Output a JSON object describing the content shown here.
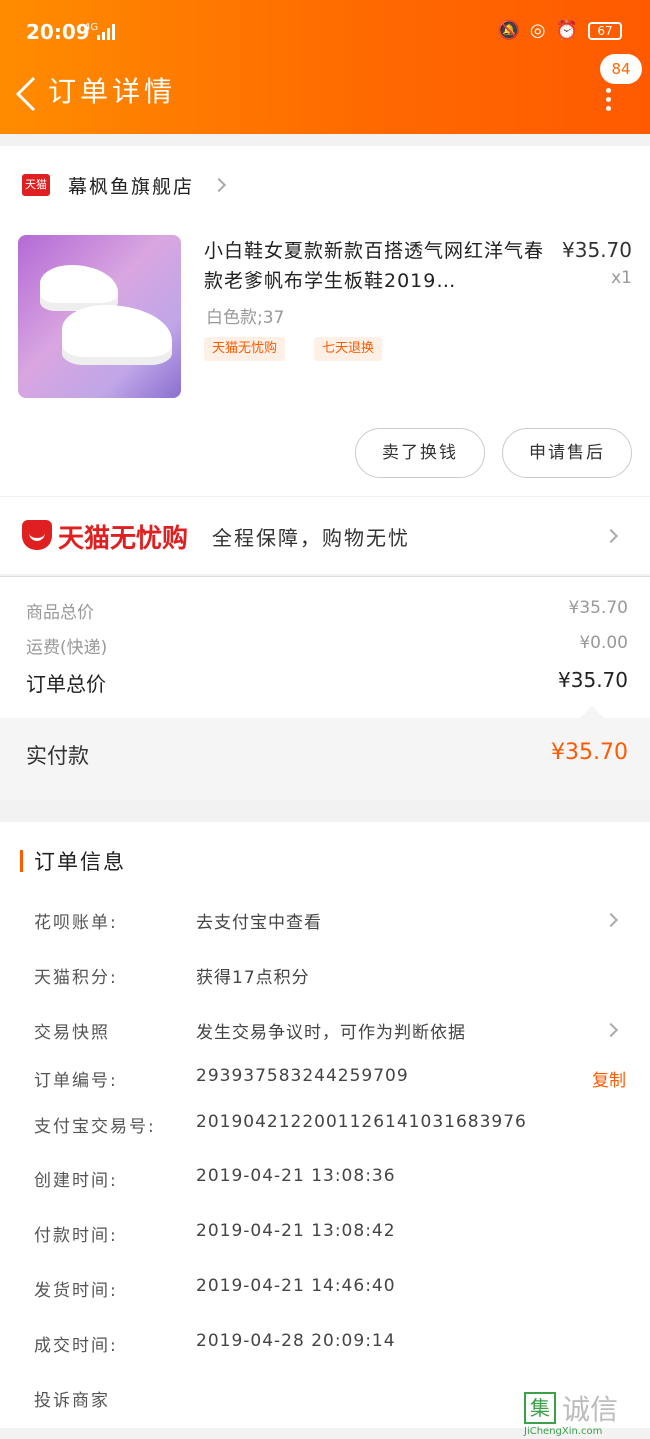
{
  "status_bar": {
    "time": "20:09",
    "network": "4G",
    "battery": "67"
  },
  "header": {
    "title": "订单详情",
    "badge": "84"
  },
  "shop": {
    "badge": "天猫",
    "name": "幕枫鱼旗舰店"
  },
  "product": {
    "title": "小白鞋女夏款新款百搭透气网红洋气春款老爹帆布学生板鞋2019…",
    "price": "¥35.70",
    "qty": "x1",
    "sku": "白色款;37",
    "tags": [
      "天猫无忧购",
      "七天退换"
    ]
  },
  "actions": {
    "buy_again": "卖了换钱",
    "after_sale": "申请售后"
  },
  "guarantee": {
    "brand": "天猫无忧购",
    "desc": "全程保障，购物无忧"
  },
  "costs": {
    "goods_label": "商品总价",
    "goods_value": "¥35.70",
    "shipping_label": "运费(快递)",
    "shipping_value": "¥0.00",
    "total_label": "订单总价",
    "total_value": "¥35.70",
    "paid_label": "实付款",
    "paid_value": "¥35.70"
  },
  "order_info": {
    "title": "订单信息",
    "rows": [
      {
        "label": "花呗账单:",
        "value": "去支付宝中查看"
      },
      {
        "label": "天猫积分:",
        "value": "获得17点积分"
      },
      {
        "label": "交易快照",
        "value": "发生交易争议时，可作为判断依据"
      },
      {
        "label": "订单编号:",
        "value": "293937583244259709"
      },
      {
        "label": "支付宝交易号:",
        "value": "2019042122001126141031683976"
      },
      {
        "label": "创建时间:",
        "value": "2019-04-21 13:08:36"
      },
      {
        "label": "付款时间:",
        "value": "2019-04-21 13:08:42"
      },
      {
        "label": "发货时间:",
        "value": "2019-04-21 14:46:40"
      },
      {
        "label": "成交时间:",
        "value": "2019-04-28 20:09:14"
      },
      {
        "label": "投诉商家",
        "value": ""
      }
    ],
    "copy": "复制"
  },
  "watermark": {
    "box": "集",
    "text": "诚信",
    "url": "JiChengXin.com"
  }
}
